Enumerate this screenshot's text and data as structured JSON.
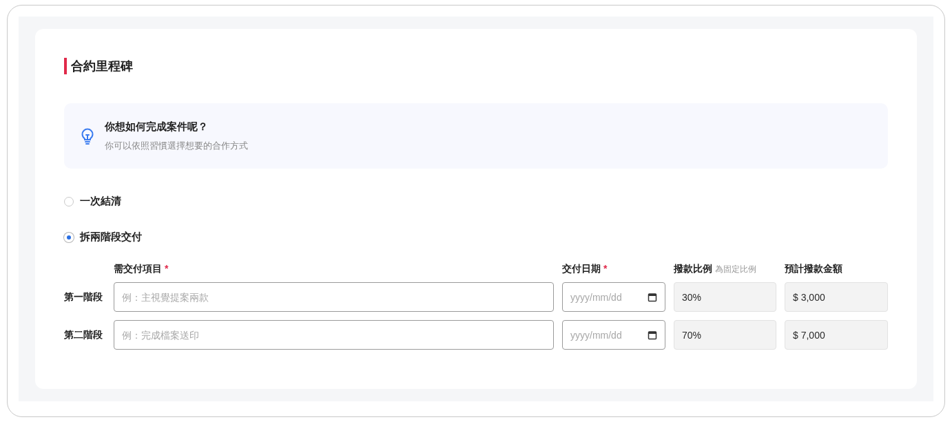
{
  "section_title": "合約里程碑",
  "tip": {
    "title": "你想如何完成案件呢？",
    "text": "你可以依照習慣選擇想要的合作方式"
  },
  "options": [
    {
      "label": "一次結清",
      "selected": false
    },
    {
      "label": "拆兩階段交付",
      "selected": true
    }
  ],
  "columns": [
    {
      "label": "需交付項目",
      "mark": "*"
    },
    {
      "label": "交付日期",
      "mark": "*"
    },
    {
      "label": "撥款比例",
      "note": "為固定比例"
    },
    {
      "label": "預計撥款金額"
    }
  ],
  "rows": [
    {
      "stage": "第一階段",
      "item_placeholder": "例：主視覺提案兩款",
      "date_placeholder": "yyyy/mm/dd",
      "ratio": "30%",
      "amount": "$ 3,000"
    },
    {
      "stage": "第二階段",
      "item_placeholder": "例：完成檔案送印",
      "date_placeholder": "yyyy/mm/dd",
      "ratio": "70%",
      "amount": "$ 7,000"
    }
  ]
}
